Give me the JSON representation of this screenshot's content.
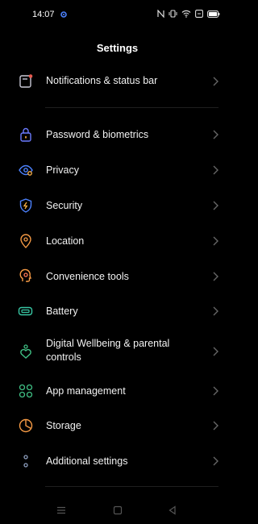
{
  "status_bar": {
    "time": "14:07"
  },
  "header": {
    "title": "Settings"
  },
  "items": [
    {
      "label": "Notifications & status bar",
      "icon": "notification-icon",
      "color": "#e85a4f"
    },
    {
      "label": "Password & biometrics",
      "icon": "lock-icon",
      "color": "#6b7bff"
    },
    {
      "label": "Privacy",
      "icon": "privacy-eye-icon",
      "color": "#4c82ff"
    },
    {
      "label": "Security",
      "icon": "shield-icon",
      "color": "#4c82ff"
    },
    {
      "label": "Location",
      "icon": "location-pin-icon",
      "color": "#f59a45"
    },
    {
      "label": "Convenience tools",
      "icon": "convenience-icon",
      "color": "#f59a45"
    },
    {
      "label": "Battery",
      "icon": "battery-icon",
      "color": "#38c6a4"
    },
    {
      "label": "Digital Wellbeing & parental controls",
      "icon": "wellbeing-heart-icon",
      "color": "#3fbf84"
    },
    {
      "label": "App management",
      "icon": "app-grid-icon",
      "color": "#3fbf84"
    },
    {
      "label": "Storage",
      "icon": "storage-pie-icon",
      "color": "#f59a45"
    },
    {
      "label": "Additional settings",
      "icon": "more-dots-icon",
      "color": "#8fa0c0"
    }
  ]
}
